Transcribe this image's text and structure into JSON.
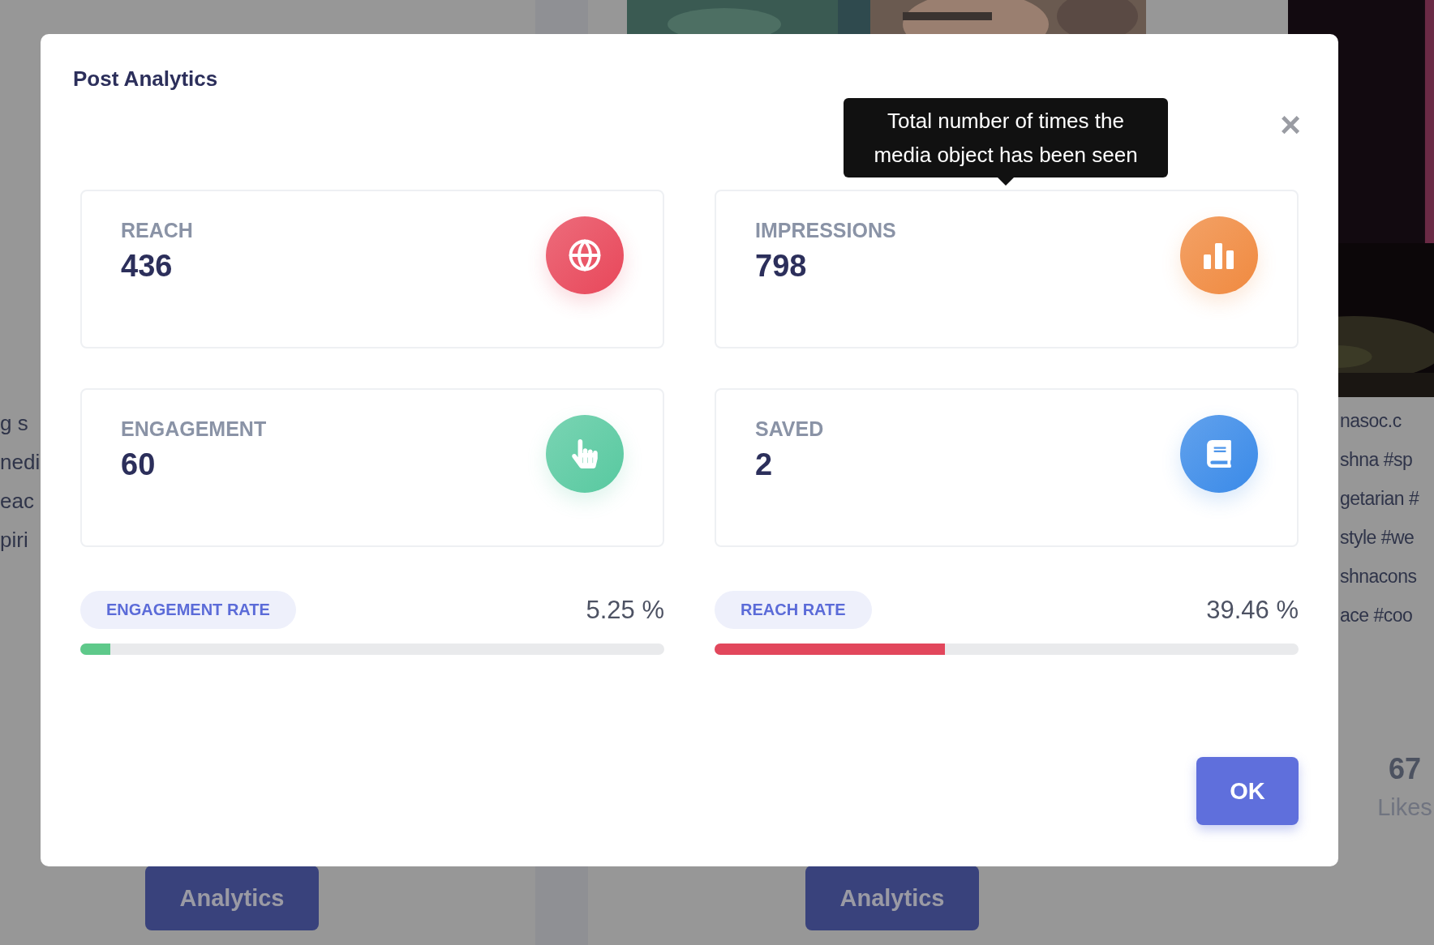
{
  "background": {
    "left_column": {
      "lines": [
        "g s",
        "nedi",
        "eac",
        "piri"
      ],
      "button": "Analytics"
    },
    "middle_column": {
      "button": "Analytics"
    },
    "right_column": {
      "lines": [
        "nasoc.c",
        "shna #sp",
        "getarian #",
        "style #we",
        "shnacons",
        "ace #coo"
      ],
      "likes_count": "67",
      "likes_label": "Likes"
    }
  },
  "dialog": {
    "title": "Post Analytics",
    "close": "×",
    "tooltip": "Total number of times the media object has been seen",
    "stats": [
      {
        "label": "REACH",
        "value": "436",
        "kind": "globe",
        "color": "#e8475a"
      },
      {
        "label": "IMPRESSIONS",
        "value": "798",
        "kind": "bars",
        "color": "#f08a40"
      },
      {
        "label": "ENGAGEMENT",
        "value": "60",
        "kind": "hand",
        "color": "#58c9a0"
      },
      {
        "label": "SAVED",
        "value": "2",
        "kind": "book",
        "color": "#3a8ae8"
      }
    ],
    "rates": [
      {
        "label": "ENGAGEMENT RATE",
        "value": "5.25 %",
        "level": 0.052,
        "color": "#5ec98a"
      },
      {
        "label": "REACH RATE",
        "value": "39.46 %",
        "level": 0.394,
        "color": "#e2475c"
      }
    ],
    "ok_button": "OK"
  }
}
